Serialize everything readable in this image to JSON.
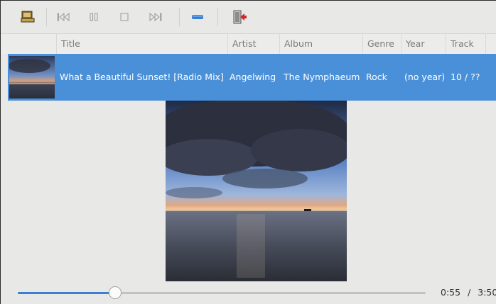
{
  "toolbar": {
    "buttons": [
      {
        "name": "open-folder-button",
        "icon": "folder-icon"
      },
      {
        "name": "previous-button",
        "icon": "skip-back-icon"
      },
      {
        "name": "pause-button",
        "icon": "pause-icon"
      },
      {
        "name": "stop-button",
        "icon": "stop-icon"
      },
      {
        "name": "next-button",
        "icon": "skip-forward-icon"
      },
      {
        "name": "volume-button",
        "icon": "volume-bar-icon"
      },
      {
        "name": "quit-button",
        "icon": "exit-icon"
      }
    ]
  },
  "columns": {
    "title": "Title",
    "artist": "Artist",
    "album": "Album",
    "genre": "Genre",
    "year": "Year",
    "track": "Track"
  },
  "track": {
    "title": "What a Beautiful Sunset! [Radio Mix]",
    "artist": "Angelwing",
    "album": "The Nymphaeum",
    "genre": "Rock",
    "year": "(no year)",
    "track": "10 / ??"
  },
  "playback": {
    "elapsed": "0:55",
    "separator": "/",
    "total": "3:50",
    "progress_fraction": 0.239
  },
  "colors": {
    "selection": "#4a90d9",
    "accent": "#3b7fd4"
  }
}
